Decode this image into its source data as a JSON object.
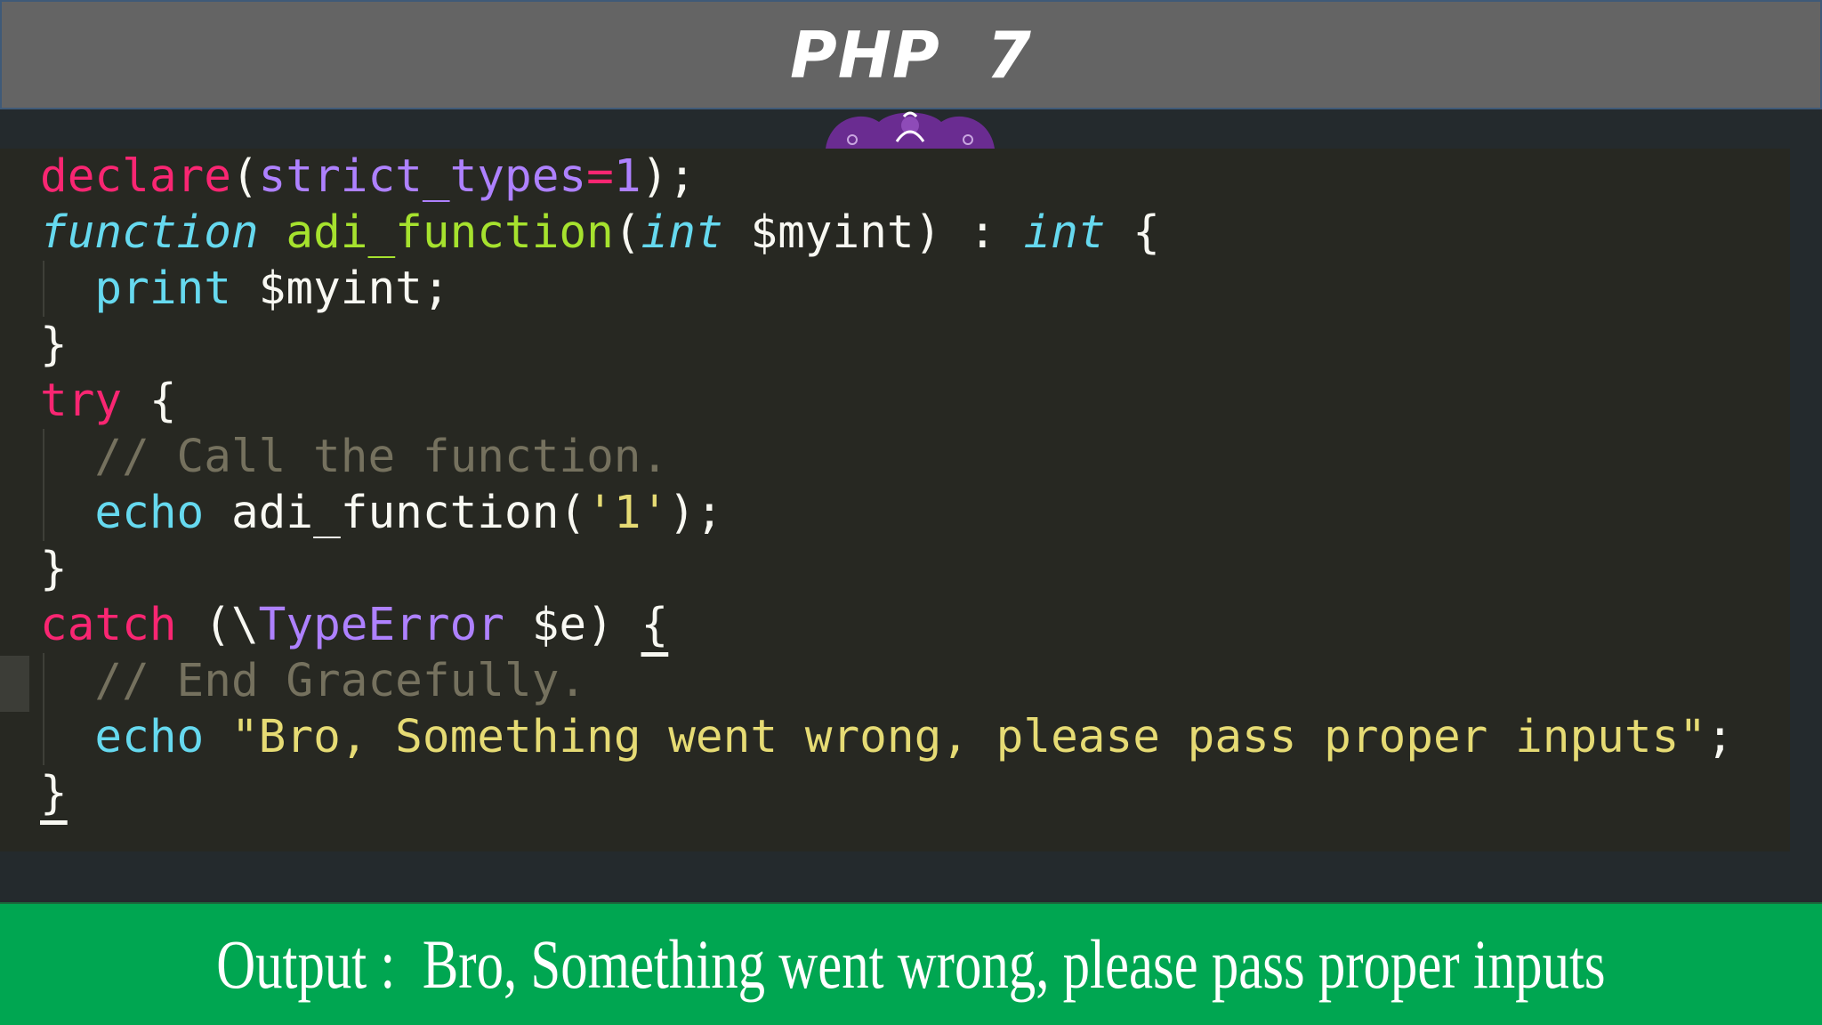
{
  "header": {
    "title": "PHP  7"
  },
  "code": {
    "line1": {
      "kw": "declare",
      "open": "(",
      "arg": "strict_types",
      "eq": "=",
      "num": "1",
      "close": ");"
    },
    "line2": {
      "kw": "function",
      "name": "adi_function",
      "open": "(",
      "type": "int",
      "var": " $myint) : ",
      "ret": "int",
      "brace": " {"
    },
    "line3": {
      "kw": "print",
      "rest": " $myint;"
    },
    "line4": {
      "brace": "}"
    },
    "line5": {
      "kw": "try",
      "brace": " {"
    },
    "line6": {
      "comment": "// Call the function."
    },
    "line7": {
      "kw": "echo",
      "call": " adi_function(",
      "str": "'1'",
      "end": ");"
    },
    "line8": {
      "brace": "}"
    },
    "line9": {
      "kw": "catch",
      "open": " (\\",
      "cls": "TypeError",
      "var": " $e) ",
      "brace": "{"
    },
    "line10": {
      "comment": "// End Gracefully."
    },
    "line11": {
      "kw": "echo",
      "str": " \"Bro, Something went wrong, please pass proper inputs\"",
      "end": ";"
    },
    "line12": {
      "brace": "}"
    }
  },
  "output": {
    "text": "Output :  Bro, Something went wrong, please pass proper inputs"
  },
  "colors": {
    "title_bar": "#646464",
    "code_bg": "#272822",
    "output_bar": "#00a651"
  }
}
